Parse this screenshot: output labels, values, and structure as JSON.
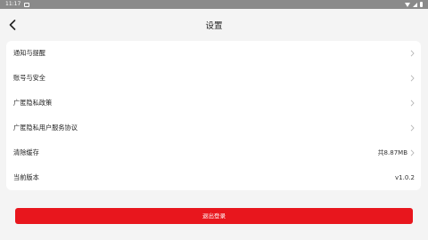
{
  "status_bar": {
    "time": "11:17"
  },
  "header": {
    "title": "设置"
  },
  "settings": {
    "items": [
      {
        "label": "通知与提醒",
        "value": ""
      },
      {
        "label": "账号与安全",
        "value": ""
      },
      {
        "label": "广匿隐私政策",
        "value": ""
      },
      {
        "label": "广匿隐私用户服务协议",
        "value": ""
      },
      {
        "label": "清除缓存",
        "value": "共8.87MB"
      },
      {
        "label": "当前版本",
        "value": "v1.0.2"
      }
    ]
  },
  "logout": {
    "label": "退出登录"
  },
  "colors": {
    "accent": "#e8161d",
    "background": "#f4f4f4"
  }
}
